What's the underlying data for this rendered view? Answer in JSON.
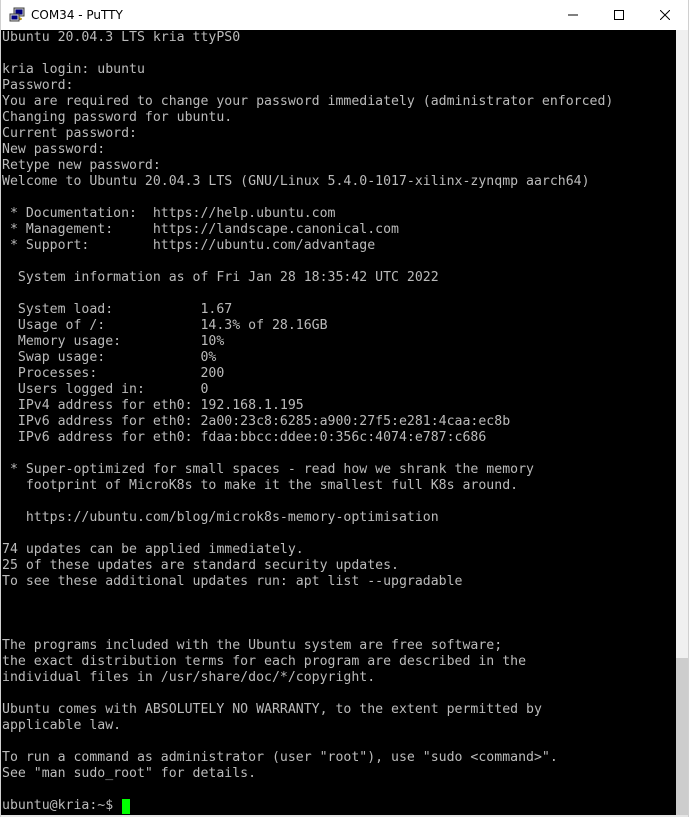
{
  "window": {
    "title": "COM34 - PuTTY",
    "icon": "putty-icon",
    "controls": [
      "minimize-icon",
      "maximize-icon",
      "close-icon"
    ]
  },
  "terminal": {
    "lines": [
      "Ubuntu 20.04.3 LTS kria ttyPS0",
      "",
      "kria login: ubuntu",
      "Password:",
      "You are required to change your password immediately (administrator enforced)",
      "Changing password for ubuntu.",
      "Current password:",
      "New password:",
      "Retype new password:",
      "Welcome to Ubuntu 20.04.3 LTS (GNU/Linux 5.4.0-1017-xilinx-zynqmp aarch64)",
      "",
      " * Documentation:  https://help.ubuntu.com",
      " * Management:     https://landscape.canonical.com",
      " * Support:        https://ubuntu.com/advantage",
      "",
      "  System information as of Fri Jan 28 18:35:42 UTC 2022",
      "",
      "  System load:           1.67",
      "  Usage of /:            14.3% of 28.16GB",
      "  Memory usage:          10%",
      "  Swap usage:            0%",
      "  Processes:             200",
      "  Users logged in:       0",
      "  IPv4 address for eth0: 192.168.1.195",
      "  IPv6 address for eth0: 2a00:23c8:6285:a900:27f5:e281:4caa:ec8b",
      "  IPv6 address for eth0: fdaa:bbcc:ddee:0:356c:4074:e787:c686",
      "",
      " * Super-optimized for small spaces - read how we shrank the memory",
      "   footprint of MicroK8s to make it the smallest full K8s around.",
      "",
      "   https://ubuntu.com/blog/microk8s-memory-optimisation",
      "",
      "74 updates can be applied immediately.",
      "25 of these updates are standard security updates.",
      "To see these additional updates run: apt list --upgradable",
      "",
      "",
      "",
      "The programs included with the Ubuntu system are free software;",
      "the exact distribution terms for each program are described in the",
      "individual files in /usr/share/doc/*/copyright.",
      "",
      "Ubuntu comes with ABSOLUTELY NO WARRANTY, to the extent permitted by",
      "applicable law.",
      "",
      "To run a command as administrator (user \"root\"), use \"sudo <command>\".",
      "See \"man sudo_root\" for details.",
      ""
    ],
    "prompt": "ubuntu@kria:~$ ",
    "text_color": "#bbbbbb",
    "background_color": "#000000",
    "cursor_color": "#00ff00"
  }
}
